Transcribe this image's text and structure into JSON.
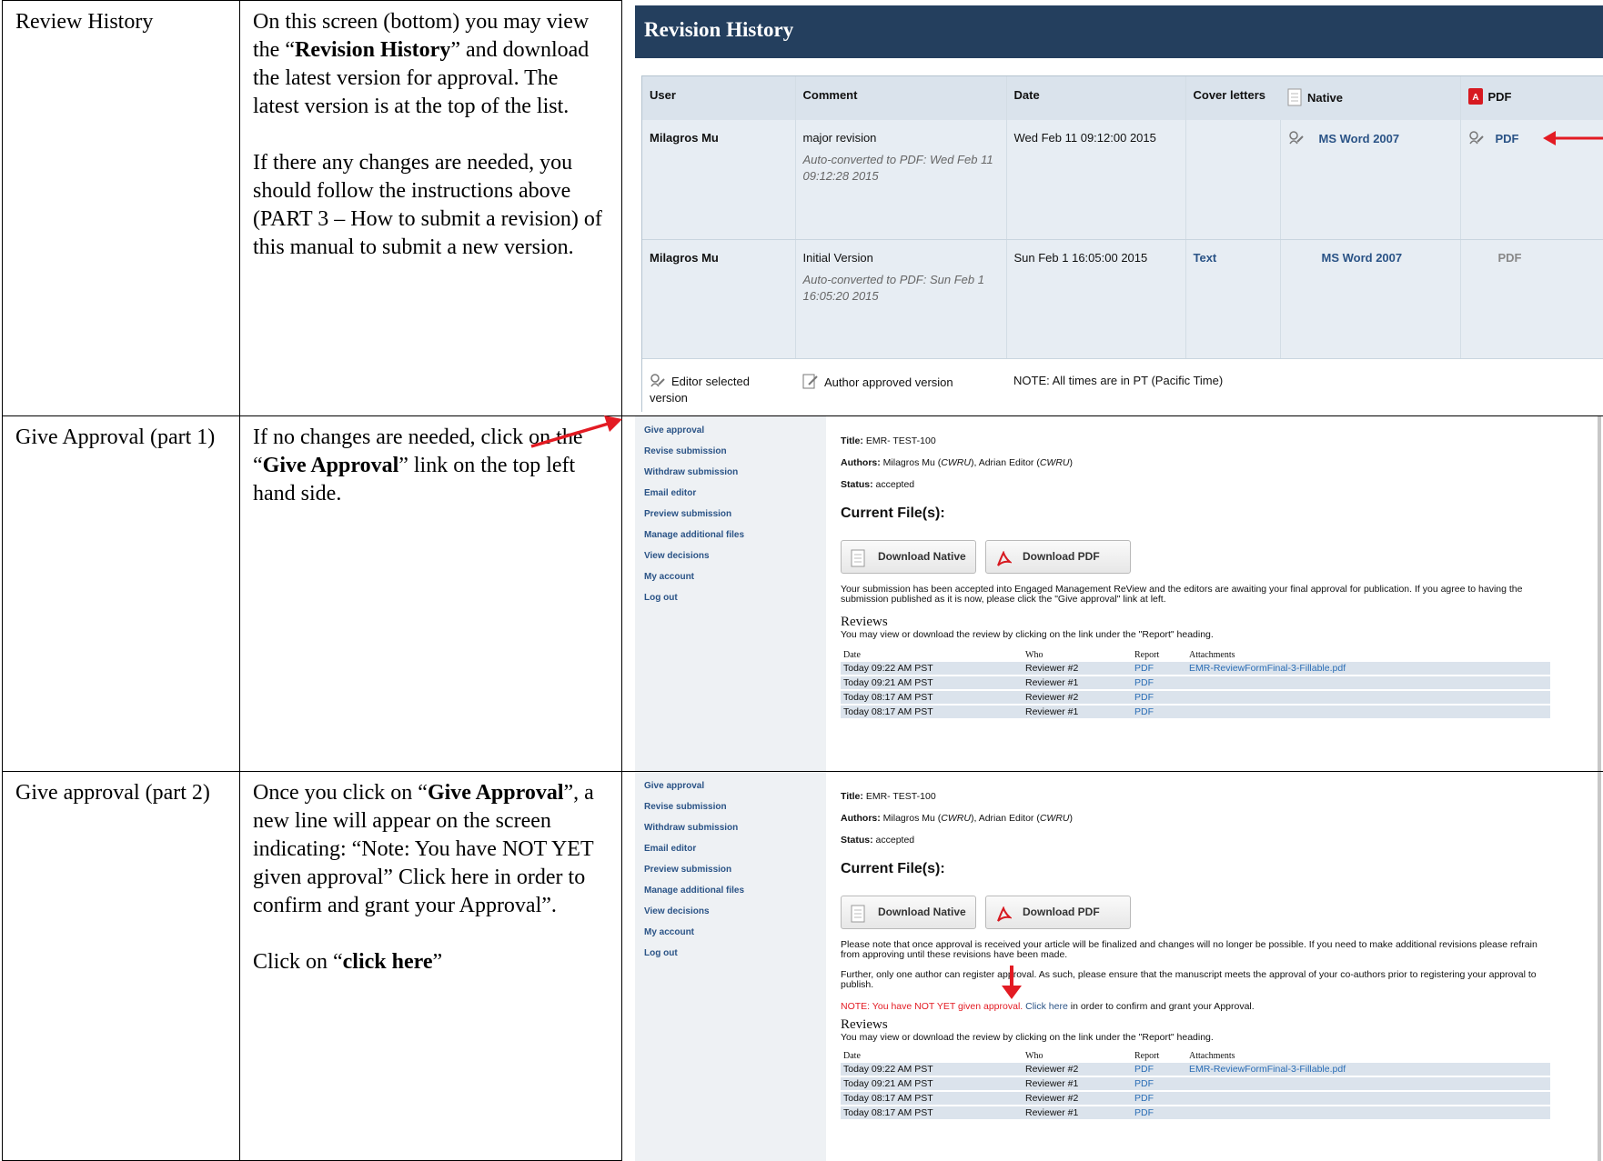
{
  "rows": [
    {
      "label": "Review History",
      "desc": [
        {
          "parts": [
            {
              "t": "On this screen (bottom) you may view the “"
            },
            {
              "t": "Revision History",
              "b": true
            },
            {
              "t": "” and download the latest version for approval.  The latest version is at the top of the list."
            }
          ]
        },
        {
          "parts": [
            {
              "t": "If there any changes are needed, you should follow the instructions above (PART 3 – How to submit a revision) of this manual to submit a new version."
            }
          ]
        }
      ]
    },
    {
      "label": "Give Approval (part 1)",
      "desc": [
        {
          "parts": [
            {
              "t": "If no changes are needed, click on the “"
            },
            {
              "t": "Give Approval",
              "b": true
            },
            {
              "t": "” link on the top left hand side."
            }
          ]
        }
      ]
    },
    {
      "label": "Give approval (part 2)",
      "desc": [
        {
          "parts": [
            {
              "t": "Once you click on “"
            },
            {
              "t": "Give Approval",
              "b": true
            },
            {
              "t": "”, a new line will appear on the screen indicating: “Note: You have NOT YET given approval” Click here in order to confirm and grant your Approval”."
            }
          ]
        },
        {
          "parts": [
            {
              "t": "Click on “"
            },
            {
              "t": "click here",
              "b": true
            },
            {
              "t": "”"
            }
          ]
        }
      ]
    }
  ],
  "revision_history": {
    "title": "Revision History",
    "headers": {
      "user": "User",
      "comment": "Comment",
      "date": "Date",
      "cover": "Cover letters",
      "native": "Native",
      "pdf": "PDF"
    },
    "rows": [
      {
        "user": "Milagros Mu",
        "comment": "major revision",
        "auto": "Auto-converted to PDF: Wed Feb 11 09:12:28 2015",
        "date": "Wed Feb 11 09:12:00 2015",
        "cover": "",
        "native": "MS Word 2007",
        "pdf": "PDF"
      },
      {
        "user": "Milagros Mu",
        "comment": "Initial Version",
        "auto": "Auto-converted to PDF: Sun Feb 1 16:05:20 2015",
        "date": "Sun Feb 1 16:05:00 2015",
        "cover": "Text",
        "native": "MS Word 2007",
        "pdf": "PDF"
      }
    ],
    "legend": {
      "editor": "Editor selected version",
      "author": "Author approved version",
      "note": "NOTE: All times are in PT (Pacific Time)"
    }
  },
  "sidebar": [
    "Give approval",
    "Revise submission",
    "Withdraw submission",
    "Email editor",
    "Preview submission",
    "Manage additional files",
    "View decisions",
    "My account",
    "Log out"
  ],
  "submission": {
    "title_label": "Title:",
    "title": "EMR- TEST-100",
    "authors_label": "Authors:",
    "author1": "Milagros Mu (",
    "aff1": "CWRU",
    "author2": "), Adrian Editor (",
    "aff2": "CWRU",
    "author_end": ")",
    "status_label": "Status:",
    "status": "accepted",
    "current_files": "Current File(s):",
    "download_native": "Download Native",
    "download_pdf": "Download PDF",
    "accepted_msg1": "Your submission has been accepted into Engaged Management ReView and the editors are awaiting your final approval for publication. If you agree to having the",
    "accepted_msg2": "submission published as it is now, please click the \"Give approval\" link at left.",
    "reviews_title": "Reviews",
    "reviews_sub": "You may view or download the review by clicking on the link under the \"Report\" heading.",
    "review_headers": [
      "Date",
      "Who",
      "Report",
      "Attachments"
    ],
    "reviews": [
      {
        "date": "Today 09:22 AM PST",
        "who": "Reviewer #2",
        "report": "PDF",
        "att": "EMR-ReviewFormFinal-3-Fillable.pdf"
      },
      {
        "date": "Today 09:21 AM PST",
        "who": "Reviewer #1",
        "report": "PDF",
        "att": ""
      },
      {
        "date": "Today 08:17 AM PST",
        "who": "Reviewer #2",
        "report": "PDF",
        "att": ""
      },
      {
        "date": "Today 08:17 AM PST",
        "who": "Reviewer #1",
        "report": "PDF",
        "att": ""
      }
    ],
    "approval_msg1": "Please note that once approval is received your article will be finalized and changes will no longer be possible. If you need to make additional revisions please refrain",
    "approval_msg2": "from approving until these revisions have been made.",
    "coauthor_msg1": "Further, only one author can register approval. As such, please ensure that the manuscript meets the approval of your co-authors prior to registering your approval to",
    "coauthor_msg2": "publish.",
    "note_red": "NOTE: You have NOT YET given approval.",
    "click_here": "Click here",
    "note_rest": " in order to confirm and grant your Approval."
  }
}
